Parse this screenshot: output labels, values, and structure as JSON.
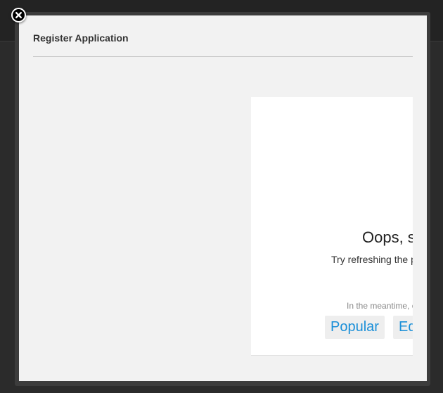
{
  "modal": {
    "title": "Register Application",
    "close_icon": "close-icon"
  },
  "embed": {
    "heading": "Oops, something went wrong.",
    "message": "Try refreshing the page.",
    "meantime": "In the meantime, check out",
    "links": [
      "Popular",
      "Editors"
    ]
  },
  "colors": {
    "backdrop": "#2b2b2b",
    "modal_background": "#f2f2f2",
    "link": "#1a8fd8"
  }
}
